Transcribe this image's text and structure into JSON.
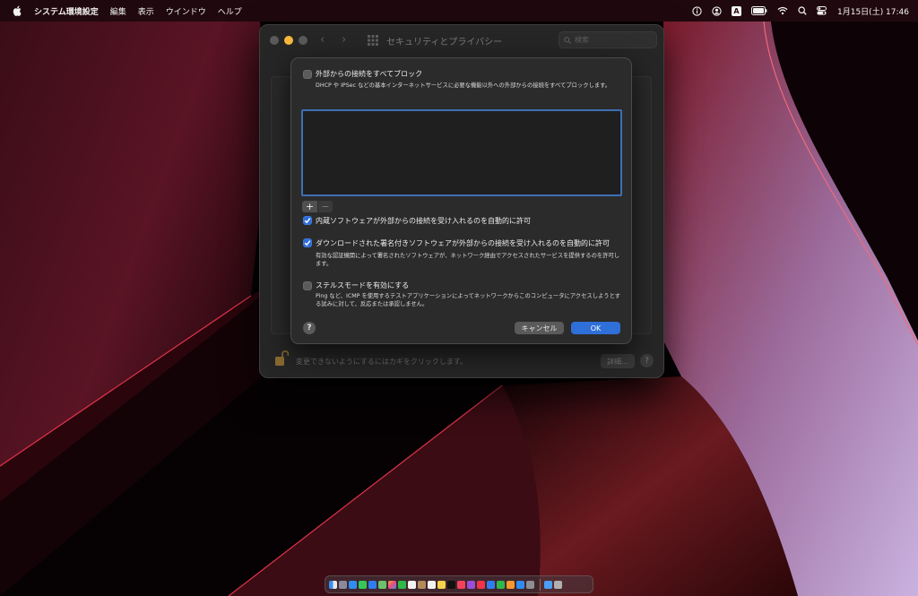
{
  "menubar": {
    "app_name": "システム環境設定",
    "menus": [
      "編集",
      "表示",
      "ウインドウ",
      "ヘルプ"
    ],
    "clock": "1月15日(土)  17:46",
    "input_indicator": "A",
    "status_icons": [
      "info-icon",
      "user-circle-icon",
      "input-source-icon",
      "battery-icon",
      "wifi-icon",
      "spotlight-search-icon",
      "control-center-icon"
    ]
  },
  "prefs_window": {
    "title": "セキュリティとプライバシー",
    "search_placeholder": "検索",
    "lock_text": "変更できないようにするにはカギをクリックします。",
    "advanced_label": "詳細...",
    "help_label": "?"
  },
  "firewall_sheet": {
    "options": [
      {
        "label": "外部からの接続をすべてブロック",
        "checked": false,
        "description": "DHCP や IPSec などの基本インターネットサービスに必要な機能以外への外部からの接続をすべてブロックします。"
      },
      {
        "label": "内蔵ソフトウェアが外部からの接続を受け入れるのを自動的に許可",
        "checked": true,
        "description": ""
      },
      {
        "label": "ダウンロードされた署名付きソフトウェアが外部からの接続を受け入れるのを自動的に許可",
        "checked": true,
        "description": "有効な認証機関によって署名されたソフトウェアが、ネットワーク経由でアクセスされたサービスを提供するのを許可します。"
      },
      {
        "label": "ステルスモードを有効にする",
        "checked": false,
        "description": "Ping など、ICMP を使用するテストアプリケーションによってネットワークからこのコンピュータにアクセスしようとする試みに対して、反応または承認しません。"
      }
    ],
    "add_label": "+",
    "remove_label": "−",
    "help_label": "?",
    "cancel_label": "キャンセル",
    "ok_label": "OK"
  },
  "dock": {
    "apps": [
      "finder",
      "launchpad",
      "safari",
      "messages",
      "mail",
      "maps",
      "photos",
      "facetime",
      "calendar",
      "contacts",
      "reminders",
      "notes",
      "apple-tv",
      "music",
      "podcasts",
      "news",
      "keynote",
      "numbers",
      "pages",
      "app-store",
      "system-preferences",
      "downloads",
      "trash"
    ]
  }
}
